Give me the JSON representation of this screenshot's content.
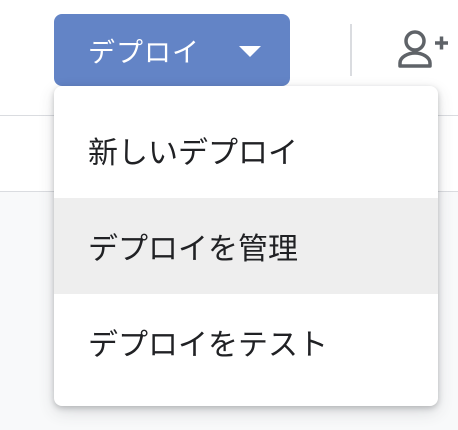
{
  "toolbar": {
    "deploy_button_label": "デプロイ",
    "deploy_button_color": "#6384c6"
  },
  "icons": {
    "deploy_caret": "caret-down-icon",
    "add_person": "person-add-icon"
  },
  "menu": {
    "items": [
      {
        "label": "新しいデプロイ",
        "highlighted": false
      },
      {
        "label": "デプロイを管理",
        "highlighted": true
      },
      {
        "label": "デプロイをテスト",
        "highlighted": false
      }
    ]
  }
}
